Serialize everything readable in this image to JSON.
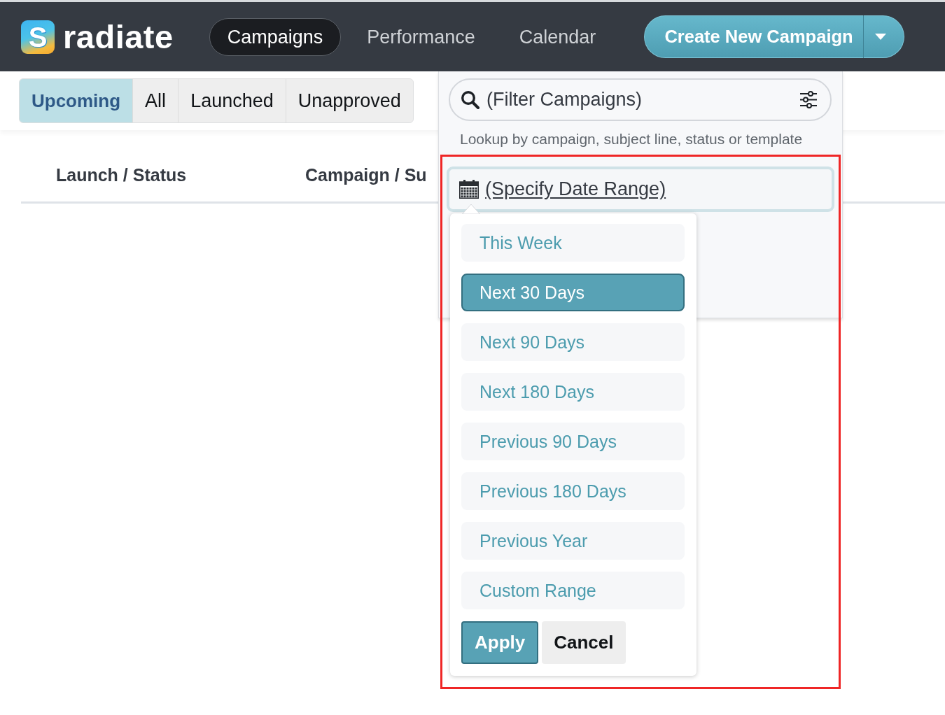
{
  "header": {
    "logo": {
      "mark": "S",
      "name": "radiate"
    },
    "nav": [
      {
        "label": "Campaigns",
        "selected": true
      },
      {
        "label": "Performance",
        "selected": false
      },
      {
        "label": "Calendar",
        "selected": false
      }
    ],
    "create_button": {
      "label": "Create New Campaign"
    }
  },
  "status_tabs": [
    {
      "label": "Upcoming",
      "selected": true
    },
    {
      "label": "All",
      "selected": false
    },
    {
      "label": "Launched",
      "selected": false
    },
    {
      "label": "Unapproved",
      "selected": false
    }
  ],
  "table": {
    "columns": [
      "Launch / Status",
      "Campaign / Su"
    ]
  },
  "filter_panel": {
    "search": {
      "placeholder": "(Filter Campaigns)"
    },
    "hint": "Lookup by campaign, subject line, status or template",
    "date_range": {
      "label": "(Specify Date Range)",
      "highlighted": true
    },
    "date_options": [
      {
        "label": "This Week",
        "selected": false
      },
      {
        "label": "Next 30 Days",
        "selected": true
      },
      {
        "label": "Next 90 Days",
        "selected": false
      },
      {
        "label": "Next 180 Days",
        "selected": false
      },
      {
        "label": "Previous 90 Days",
        "selected": false
      },
      {
        "label": "Previous 180 Days",
        "selected": false
      },
      {
        "label": "Previous Year",
        "selected": false
      },
      {
        "label": "Custom Range",
        "selected": false
      }
    ],
    "buttons": [
      {
        "label": "Apply",
        "kind": "primary"
      },
      {
        "label": "Cancel",
        "kind": "secondary"
      }
    ]
  }
}
